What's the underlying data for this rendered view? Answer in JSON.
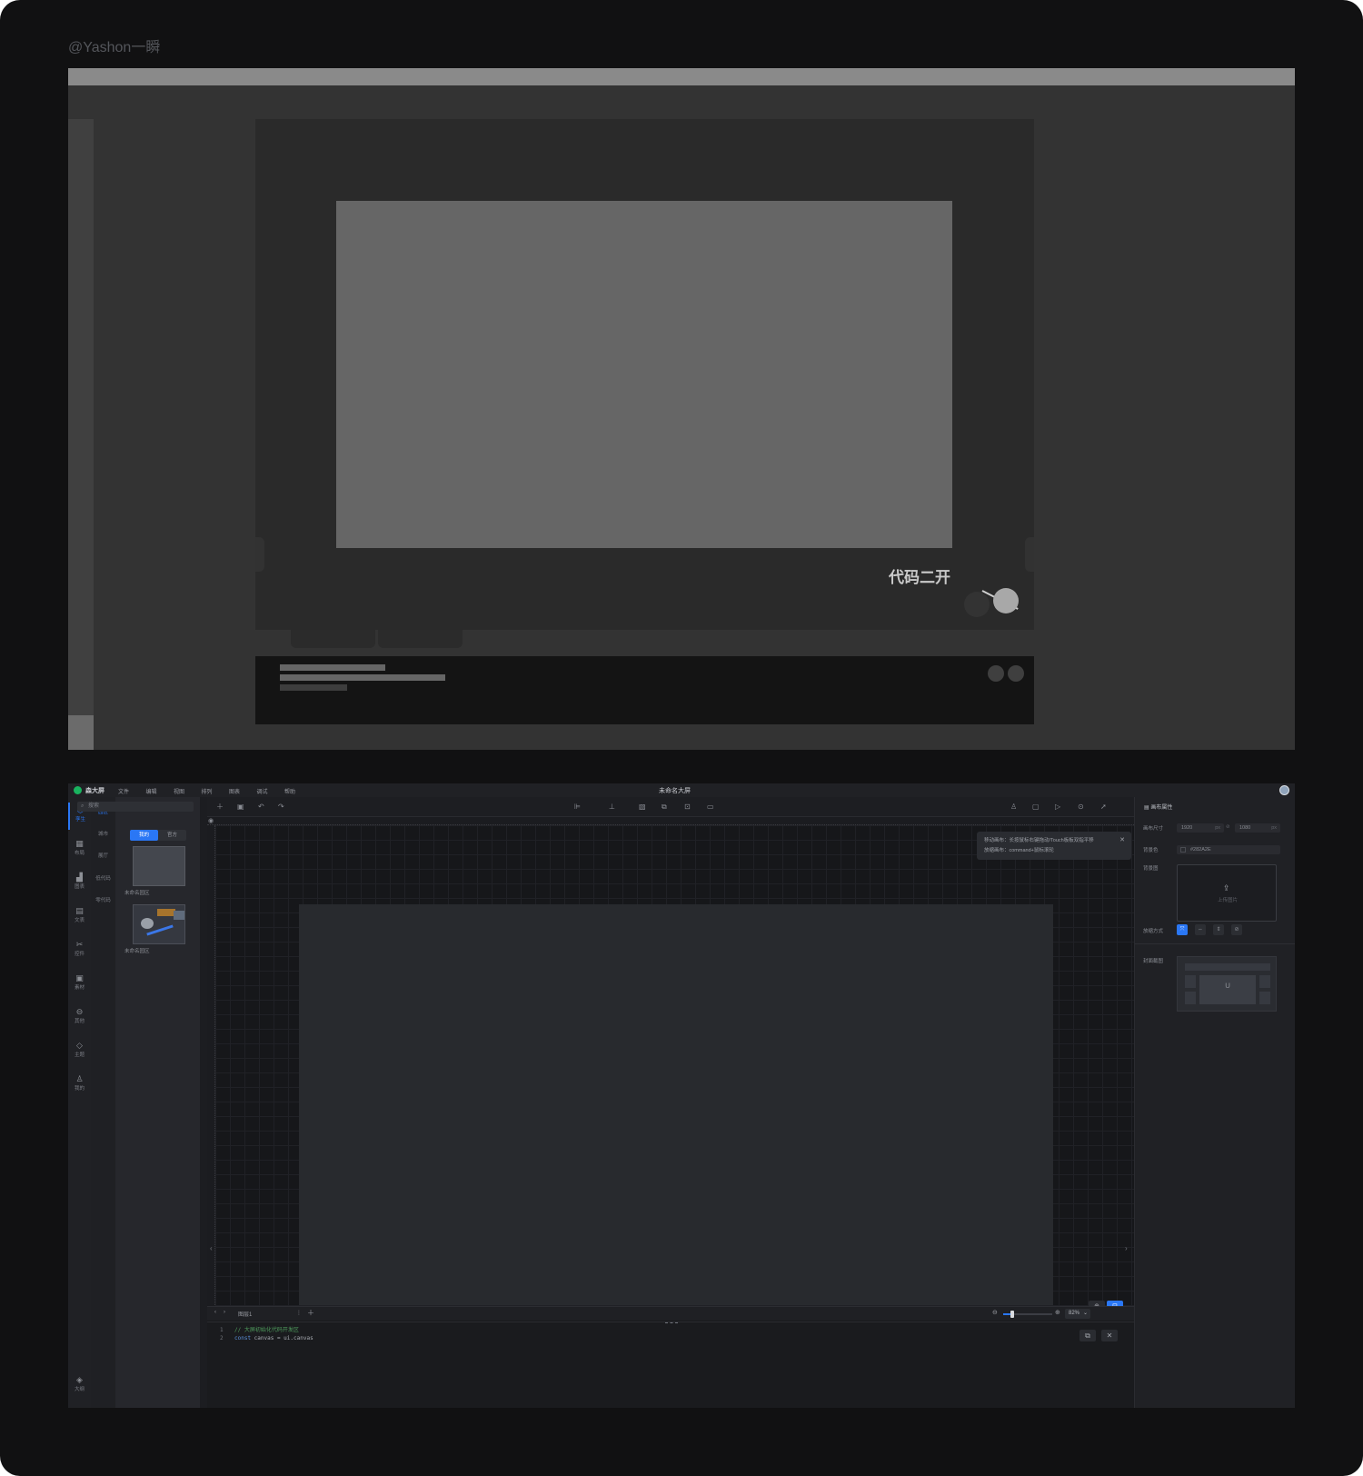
{
  "watermark": "@Yashon一瞬",
  "wireframe": {
    "callout_label": "代码二开"
  },
  "editor": {
    "brand": "森大屏",
    "title": "未命名大屏",
    "menu": [
      "文件",
      "编辑",
      "视图",
      "排列",
      "图表",
      "调试",
      "帮助"
    ],
    "rail": [
      {
        "label": "孪生",
        "icon": "twin-icon",
        "active": true
      },
      {
        "label": "布局",
        "icon": "layout-icon"
      },
      {
        "label": "图表",
        "icon": "chart-icon"
      },
      {
        "label": "文表",
        "icon": "text-table-icon"
      },
      {
        "label": "控件",
        "icon": "widget-icon"
      },
      {
        "label": "素材",
        "icon": "media-icon"
      },
      {
        "label": "其他",
        "icon": "other-icon"
      },
      {
        "label": "主题",
        "icon": "theme-icon"
      },
      {
        "label": "我的",
        "icon": "user-icon"
      }
    ],
    "rail_bottom": {
      "label": "大纲",
      "icon": "outline-icon"
    },
    "subnav": [
      "园区",
      "城市",
      "展厅",
      "低代码",
      "零代码"
    ],
    "search_placeholder": "搜索",
    "segment": {
      "mine": "我的",
      "official": "官方"
    },
    "assets": [
      "未命名园区",
      "未命名园区"
    ],
    "toast": {
      "line1": "移动画布：长按鼠标右键拖动/Touch板板双指平移",
      "line2": "放缩画布：command+鼠标滚轮"
    },
    "page_tab": "图层1",
    "zoom": "82%",
    "zoom_fraction": 0.18,
    "code": {
      "line1_no": "1",
      "line1": "// 大屏初始化代码开发区",
      "line2_no": "2",
      "line2_kw": "const",
      "line2_rest": " canvas = ui.canvas"
    },
    "props": {
      "header": "画布属性",
      "size_label": "画布尺寸",
      "width": "1920",
      "height": "1080",
      "unit": "px",
      "link_icon": "link-icon",
      "bg_color_label": "背景色",
      "bg_color": "#282A2E",
      "bg_image_label": "背景图",
      "upload_text": "上传图片",
      "fill_label": "放缩方式",
      "cover_label": "封面截图"
    },
    "colors": {
      "accent": "#2a77f5",
      "brand_green": "#19b35f",
      "canvas_bg": "#282A2E"
    }
  }
}
